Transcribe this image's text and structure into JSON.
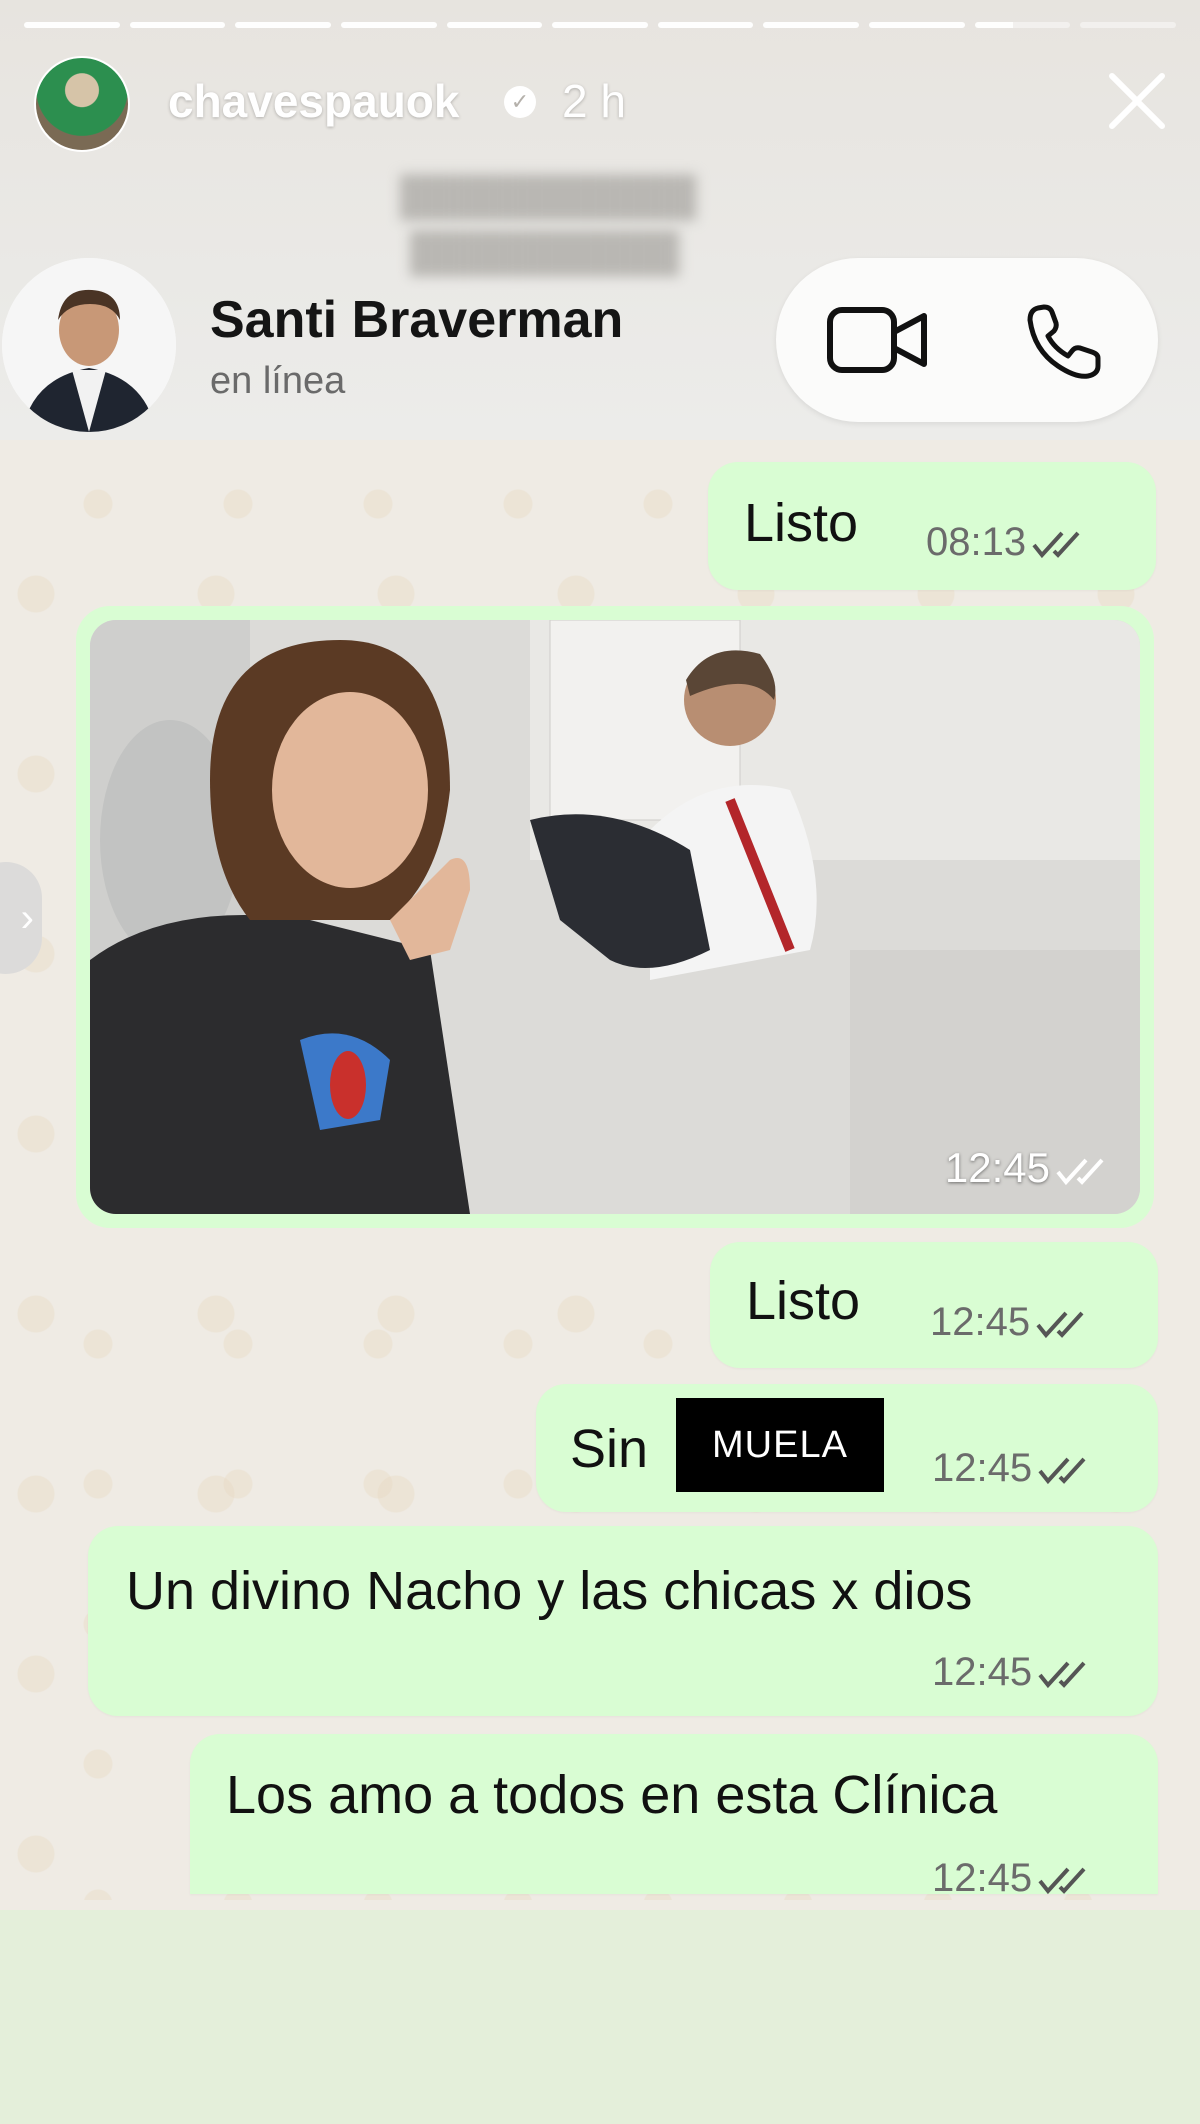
{
  "story": {
    "username": "chavespauok",
    "time": "2 h",
    "progress_segments": 11
  },
  "contact": {
    "name": "Santi Braverman",
    "status": "en línea"
  },
  "messages": [
    {
      "text": "Listo",
      "time": "08:13"
    },
    {
      "type": "image",
      "time": "12:45"
    },
    {
      "text": "Listo",
      "time": "12:45"
    },
    {
      "text": "Sin",
      "redacted_label": "MUELA",
      "time": "12:45"
    },
    {
      "text": "Un divino Nacho y las chicas x dios",
      "time": "12:45"
    },
    {
      "text": "Los amo a todos en esta Clínica",
      "time": "12:45"
    }
  ],
  "colors": {
    "bubble": "#d9fdd3",
    "chat_bg": "#efebe4",
    "footer": "#e4efda"
  }
}
